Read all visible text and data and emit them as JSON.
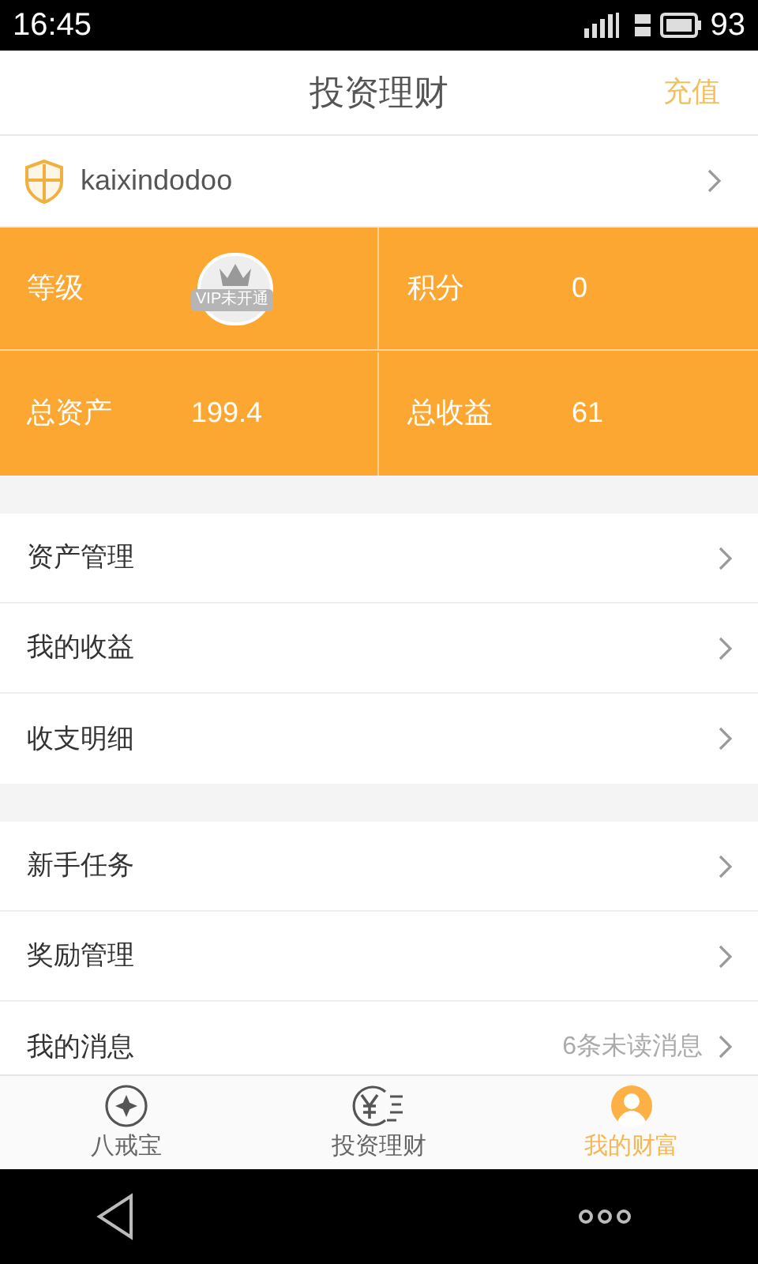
{
  "status_bar": {
    "time": "16:45",
    "battery": "93"
  },
  "header": {
    "title": "投资理财",
    "action": "充值"
  },
  "account": {
    "username": "kaixindodoo"
  },
  "stats": [
    {
      "kind": "badge",
      "label": "等级",
      "badge": "VIP未开通"
    },
    {
      "kind": "value",
      "label": "积分",
      "value": "0"
    },
    {
      "kind": "value",
      "label": "总资产",
      "value": "199.4"
    },
    {
      "kind": "value",
      "label": "总收益",
      "value": "61"
    }
  ],
  "menu_groups": [
    [
      {
        "label": "资产管理"
      },
      {
        "label": "我的收益"
      },
      {
        "label": "收支明细"
      }
    ],
    [
      {
        "label": "新手任务"
      },
      {
        "label": "奖励管理"
      },
      {
        "label": "我的消息",
        "detail": "6条未读消息"
      }
    ]
  ],
  "tabs": [
    {
      "kind": "diamond",
      "label": "八戒宝",
      "selected": false
    },
    {
      "kind": "yen",
      "label": "投资理财",
      "selected": false
    },
    {
      "kind": "person",
      "label": "我的财富",
      "selected": true
    }
  ]
}
